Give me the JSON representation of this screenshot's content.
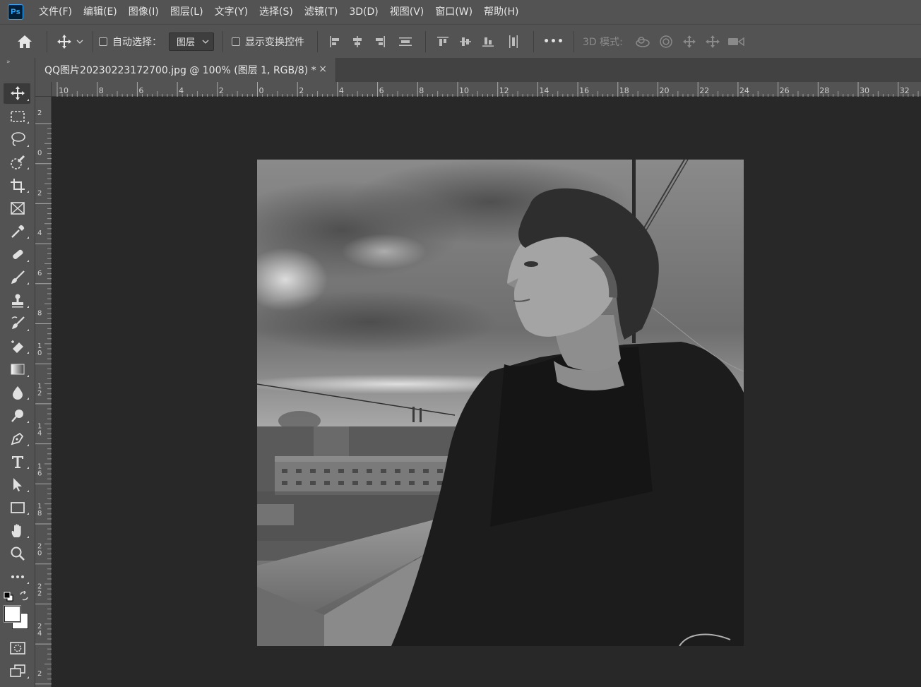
{
  "app": {
    "logo": "Ps"
  },
  "menu": [
    "文件(F)",
    "编辑(E)",
    "图像(I)",
    "图层(L)",
    "文字(Y)",
    "选择(S)",
    "滤镜(T)",
    "3D(D)",
    "视图(V)",
    "窗口(W)",
    "帮助(H)"
  ],
  "options": {
    "auto_select_label": "自动选择：",
    "auto_select_value": "图层",
    "show_transform_label": "显示变换控件",
    "more": "•••",
    "mode_3d_label": "3D 模式:"
  },
  "toolbar": {
    "grip": "»"
  },
  "document": {
    "tab_title": "QQ图片20230223172700.jpg @ 100% (图层 1, RGB/8) *",
    "close": "×"
  },
  "rulers": {
    "horizontal": [
      "10",
      "8",
      "6",
      "4",
      "2",
      "0",
      "2",
      "4",
      "6",
      "8",
      "10",
      "12",
      "14",
      "16",
      "18",
      "20",
      "22",
      "24",
      "26",
      "28",
      "30",
      "32"
    ],
    "vertical": [
      "2",
      "0",
      "2",
      "4",
      "6",
      "8",
      "10",
      "12",
      "14",
      "16",
      "18",
      "20",
      "22",
      "24",
      "2"
    ]
  },
  "colors": {
    "accent": "#31a8ff",
    "foreground": "#ffffff",
    "background": "#ffffff",
    "chrome": "#535353",
    "workspace": "#282828"
  }
}
